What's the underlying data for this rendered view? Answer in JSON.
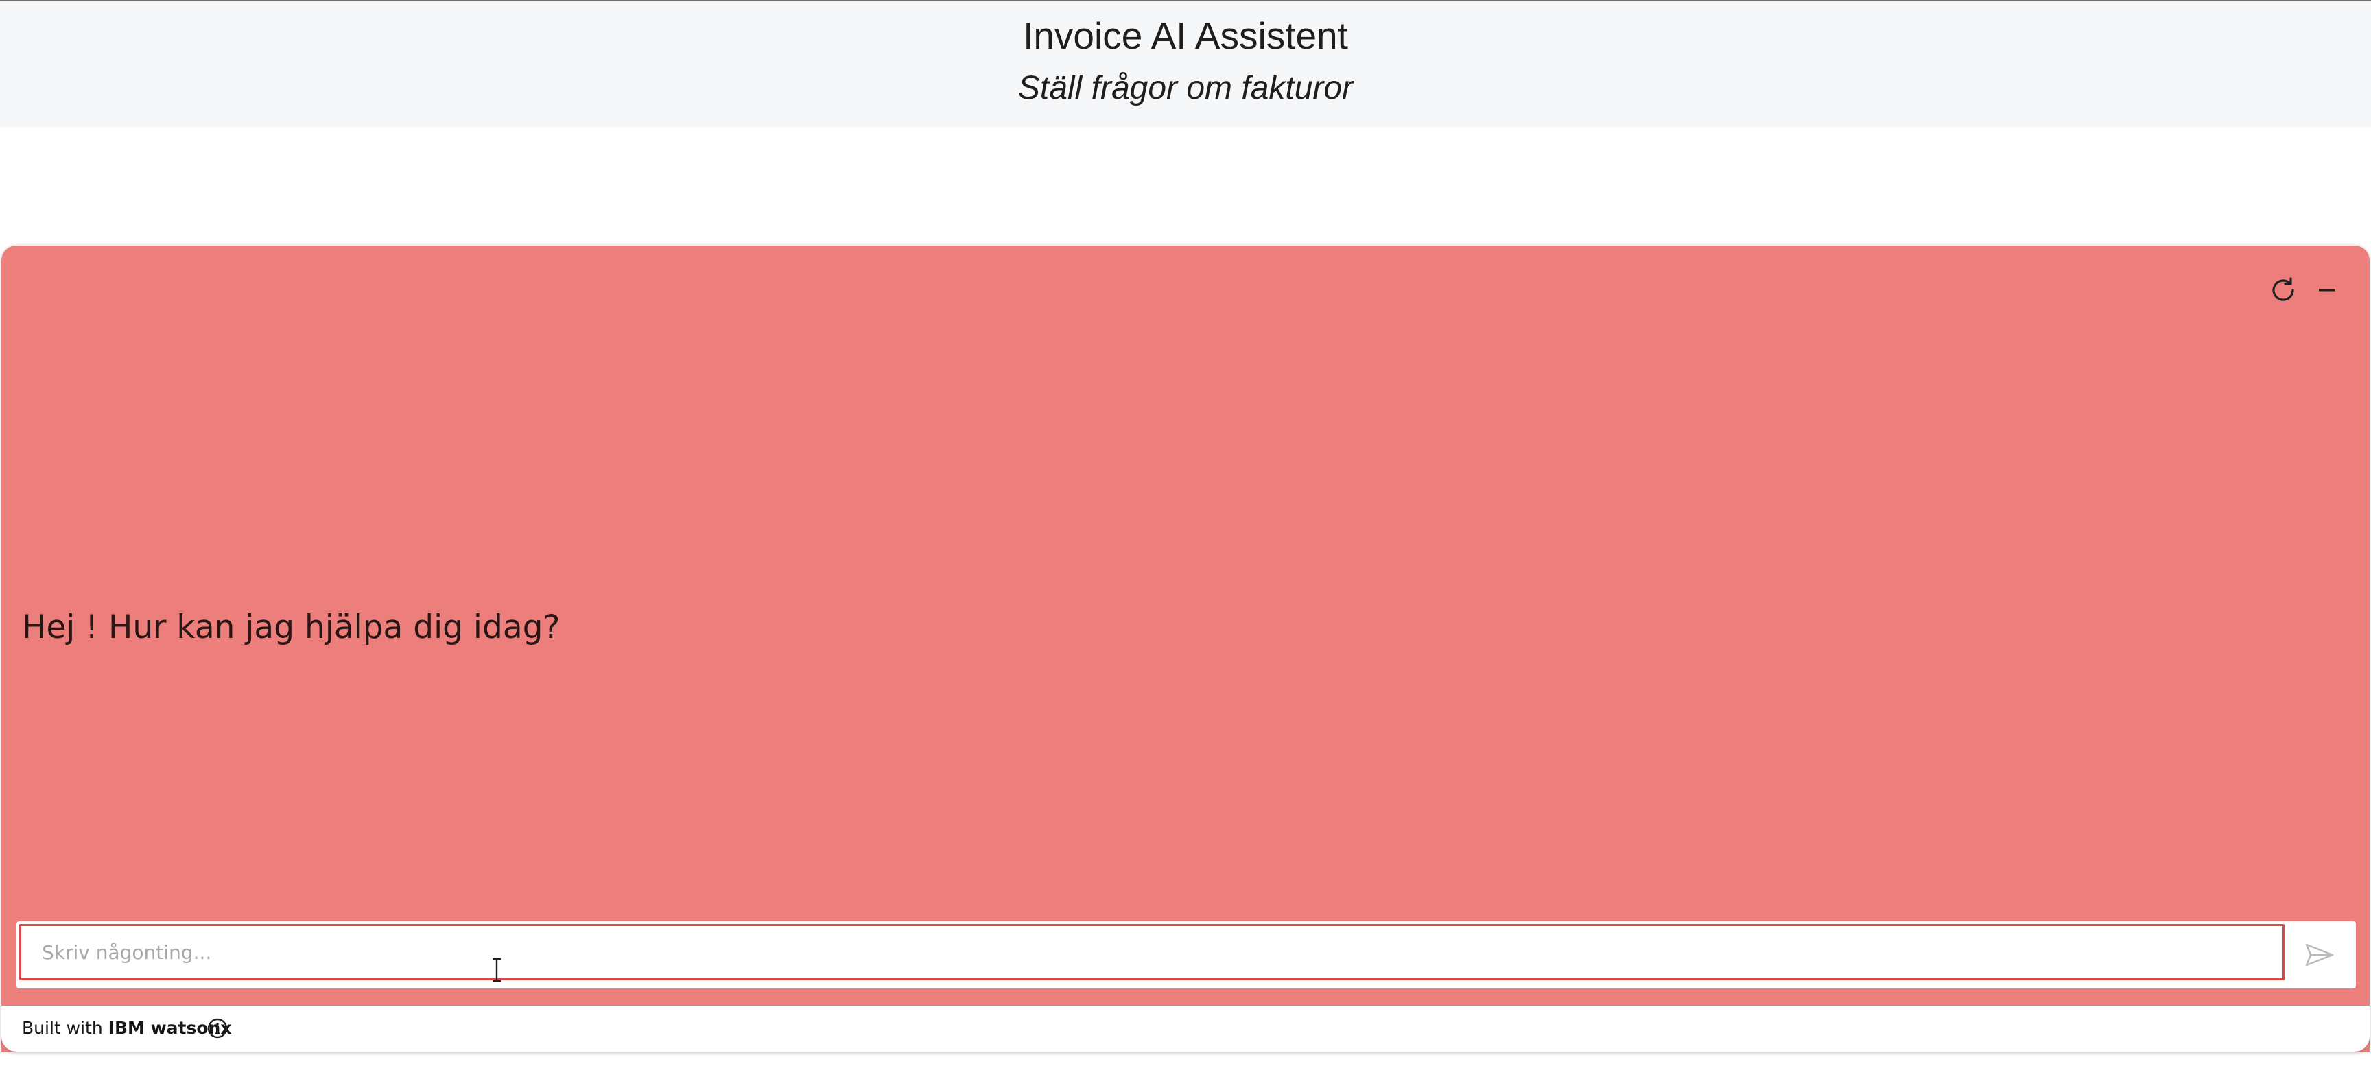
{
  "header": {
    "title": "Invoice AI Assistent",
    "subtitle": "Ställ frågor om fakturor"
  },
  "chat": {
    "welcome_message": "Hej ! Hur kan jag hjälpa dig idag?",
    "input_placeholder": "Skriv någonting...",
    "input_value": "",
    "controls": {
      "restart_icon": "restart-icon",
      "minimize_icon": "minimize-icon",
      "send_icon": "send-icon"
    }
  },
  "footer": {
    "built_with_label": "Built with",
    "brand": "IBM watsonx",
    "info_icon": "info-icon"
  },
  "colors": {
    "header_background": "#f6f7f9",
    "chat_background": "#ec7e7c",
    "input_border": "#d84a4a"
  }
}
